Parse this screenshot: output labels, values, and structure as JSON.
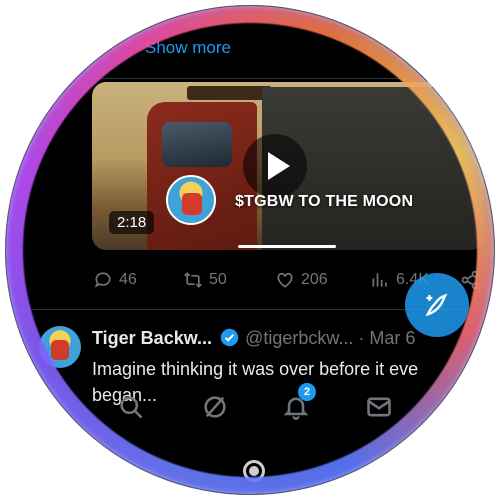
{
  "feed": {
    "show_more": "Show more"
  },
  "video": {
    "caption": "$TGBW TO THE MOON",
    "duration": "2:18",
    "progress": 0.35
  },
  "actions": {
    "replies": "46",
    "reposts": "50",
    "likes": "206",
    "views": "6.4K"
  },
  "tweet": {
    "name": "Tiger Backw...",
    "handle": "@tigerbckw...",
    "date": "· Mar 6",
    "text_line1": "Imagine thinking it was over before it eve",
    "text_line2": "began..."
  },
  "nav": {
    "notifications_badge": "2"
  },
  "colors": {
    "accent": "#1d9bf0",
    "muted": "#71767b",
    "text": "#e7e9ea",
    "background": "#000000"
  }
}
